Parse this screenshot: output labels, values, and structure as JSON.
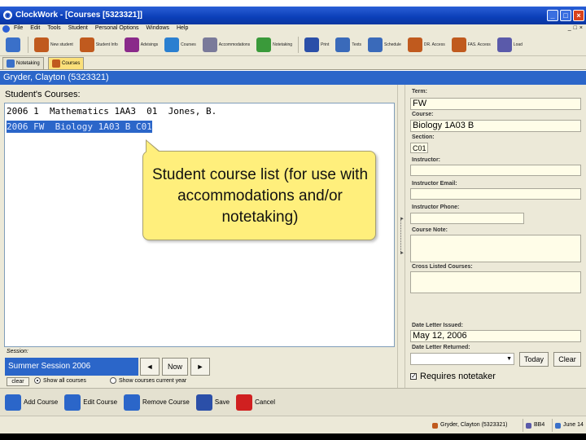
{
  "window": {
    "title": "ClockWork - [Courses [5323321]]",
    "controls": [
      "_",
      "□",
      "×"
    ]
  },
  "menu": {
    "items": [
      "File",
      "Edit",
      "Tools",
      "Student",
      "Personal Options",
      "Windows",
      "Help"
    ],
    "mdi_controls": [
      "_",
      "□",
      "×"
    ]
  },
  "toolbar": {
    "buttons": [
      {
        "label": "",
        "icon": "clock-icon",
        "color": "#3a70c9"
      },
      {
        "label": "New student",
        "icon": "new-student-icon",
        "color": "#c05a1e"
      },
      {
        "label": "Student Info",
        "icon": "student-info-icon",
        "color": "#c05a1e"
      },
      {
        "label": "Advisings",
        "icon": "advisings-icon",
        "color": "#8a2a8a"
      },
      {
        "label": "Courses",
        "icon": "courses-icon",
        "color": "#2a7fd0"
      },
      {
        "label": "Accommodations",
        "icon": "accommodations-icon",
        "color": "#7a7a9a"
      },
      {
        "label": "Notetaking",
        "icon": "notetaking-icon",
        "color": "#3a9a3a"
      },
      {
        "label": "Print",
        "icon": "print-icon",
        "color": "#2b4fa8"
      },
      {
        "label": "Texts",
        "icon": "texts-icon",
        "color": "#3a6aba"
      },
      {
        "label": "Schedule",
        "icon": "schedule-icon",
        "color": "#3a6aba"
      },
      {
        "label": "DR. Access",
        "icon": "dr-access-icon",
        "color": "#c05a1e"
      },
      {
        "label": "FAS. Access",
        "icon": "fas-access-icon",
        "color": "#c05a1e"
      },
      {
        "label": "Load",
        "icon": "load-icon",
        "color": "#5a5aaa"
      }
    ]
  },
  "tabs": [
    {
      "label": "Notetaking",
      "active": false
    },
    {
      "label": "Courses",
      "active": true
    }
  ],
  "student": {
    "header": "Gryder, Clayton (5323321)"
  },
  "courses": {
    "label": "Student's Courses:",
    "rows": [
      {
        "text": "2006 1  Mathematics 1AA3  01  Jones, B.",
        "selected": false
      },
      {
        "text": "2006 FW  Biology 1A03 B C01",
        "selected": true
      }
    ]
  },
  "section": {
    "label": "Session:",
    "value": "Summer Session 2006",
    "prev": "◄",
    "now": "Now",
    "next": "►"
  },
  "filter": {
    "clear": "clear",
    "options": [
      {
        "label": "Show all courses",
        "checked": true
      },
      {
        "label": "Show courses current year",
        "checked": false
      }
    ]
  },
  "details": {
    "term_label": "Term:",
    "term": "FW",
    "course_label": "Course:",
    "course": "Biology 1A03 B",
    "section_label": "Section:",
    "section": "C01",
    "instructor_label": "Instructor:",
    "instructor": "",
    "email_label": "Instructor Email:",
    "email": "",
    "phone_label": "Instructor Phone:",
    "phone": "",
    "note_label": "Course Note:",
    "note": "",
    "cross_label": "Cross Listed Courses:",
    "cross": "",
    "issued_label": "Date Letter Issued:",
    "issued": "May 12, 2006",
    "returned_label": "Date Letter Returned:",
    "returned": "",
    "today": "Today",
    "clear": "Clear",
    "requires_label": "Requires notetaker",
    "requires_checked": true
  },
  "actions": [
    {
      "label": "Add Course",
      "icon": "add-course-icon",
      "color": "#2b66c9"
    },
    {
      "label": "Edit Course",
      "icon": "edit-course-icon",
      "color": "#2b66c9"
    },
    {
      "label": "Remove Course",
      "icon": "remove-course-icon",
      "color": "#2b66c9"
    },
    {
      "label": "Save",
      "icon": "save-icon",
      "color": "#2b4fa8"
    },
    {
      "label": "Cancel",
      "icon": "cancel-icon",
      "color": "#d02020"
    }
  ],
  "status": {
    "user": "Gryder, Clayton (5323321)",
    "code": "BB4",
    "date": "June 14"
  },
  "callout": {
    "text": "Student course list (for use with accommodations and/or notetaking)"
  }
}
